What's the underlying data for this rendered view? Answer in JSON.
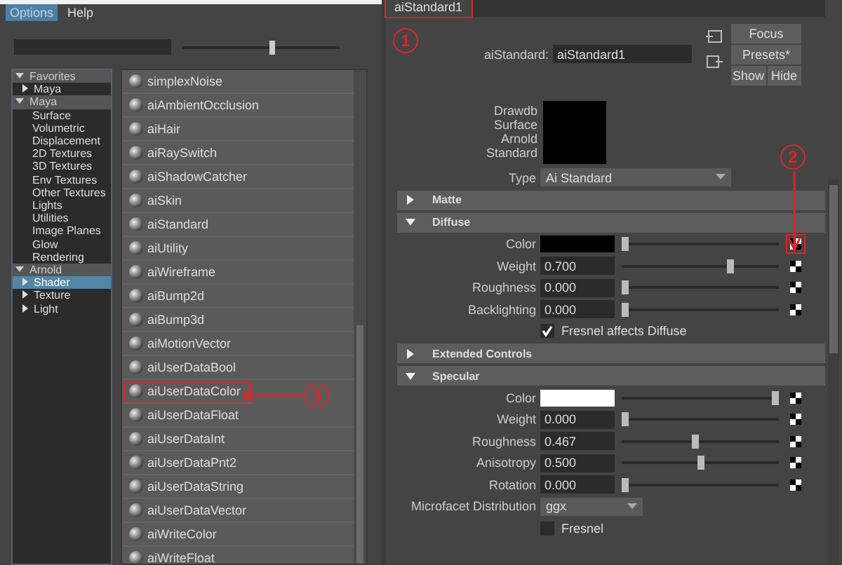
{
  "menu": [
    {
      "label": "Options",
      "selected": true
    },
    {
      "label": "Help",
      "selected": false
    }
  ],
  "zoom_slider": {
    "level": 0.55
  },
  "tree": [
    {
      "label": "Favorites",
      "kind": "group",
      "expanded": true,
      "selected": false,
      "children": [
        {
          "label": "Maya",
          "kind": "node",
          "expanded": false,
          "selected": false
        }
      ]
    },
    {
      "label": "Maya",
      "kind": "group",
      "expanded": true,
      "selected": false,
      "children": [
        {
          "label": "Surface",
          "kind": "leaf",
          "selected": false
        },
        {
          "label": "Volumetric",
          "kind": "leaf",
          "selected": false
        },
        {
          "label": "Displacement",
          "kind": "leaf",
          "selected": false
        },
        {
          "label": "2D Textures",
          "kind": "leaf",
          "selected": false
        },
        {
          "label": "3D Textures",
          "kind": "leaf",
          "selected": false
        },
        {
          "label": "Env Textures",
          "kind": "leaf",
          "selected": false
        },
        {
          "label": "Other Textures",
          "kind": "leaf",
          "selected": false
        },
        {
          "label": "Lights",
          "kind": "leaf",
          "selected": false
        },
        {
          "label": "Utilities",
          "kind": "leaf",
          "selected": false
        },
        {
          "label": "Image Planes",
          "kind": "leaf",
          "selected": false
        },
        {
          "label": "Glow",
          "kind": "leaf",
          "selected": false
        },
        {
          "label": "Rendering",
          "kind": "leaf",
          "selected": false
        }
      ]
    },
    {
      "label": "Arnold",
      "kind": "group",
      "expanded": true,
      "selected": false,
      "children": [
        {
          "label": "Shader",
          "kind": "node",
          "expanded": false,
          "selected": true
        },
        {
          "label": "Texture",
          "kind": "node",
          "expanded": false,
          "selected": false
        },
        {
          "label": "Light",
          "kind": "node",
          "expanded": false,
          "selected": false
        }
      ]
    }
  ],
  "nodes": [
    {
      "label": "simplexNoise",
      "annotated": false
    },
    {
      "label": "aiAmbientOcclusion",
      "annotated": false
    },
    {
      "label": "aiHair",
      "annotated": false
    },
    {
      "label": "aiRaySwitch",
      "annotated": false
    },
    {
      "label": "aiShadowCatcher",
      "annotated": false
    },
    {
      "label": "aiSkin",
      "annotated": false
    },
    {
      "label": "aiStandard",
      "annotated": false
    },
    {
      "label": "aiUtility",
      "annotated": false
    },
    {
      "label": "aiWireframe",
      "annotated": false
    },
    {
      "label": "aiBump2d",
      "annotated": false
    },
    {
      "label": "aiBump3d",
      "annotated": false
    },
    {
      "label": "aiMotionVector",
      "annotated": false
    },
    {
      "label": "aiUserDataBool",
      "annotated": false
    },
    {
      "label": "aiUserDataColor",
      "annotated": true
    },
    {
      "label": "aiUserDataFloat",
      "annotated": false
    },
    {
      "label": "aiUserDataInt",
      "annotated": false
    },
    {
      "label": "aiUserDataPnt2",
      "annotated": false
    },
    {
      "label": "aiUserDataString",
      "annotated": false
    },
    {
      "label": "aiUserDataVector",
      "annotated": false
    },
    {
      "label": "aiWriteColor",
      "annotated": false
    },
    {
      "label": "aiWriteFloat",
      "annotated": false
    }
  ],
  "tab": {
    "label": "aiStandard1",
    "annotated": true
  },
  "node_name": {
    "label": "aiStandard:",
    "value": "aiStandard1"
  },
  "buttons": [
    "Focus",
    "Presets*",
    "Show",
    "Hide"
  ],
  "swatch": {
    "label": "Drawdb Surface Arnold Standard"
  },
  "type": {
    "label": "Type",
    "value": "Ai Standard"
  },
  "sections": [
    {
      "title": "Matte",
      "expanded": false
    },
    {
      "title": "Diffuse",
      "expanded": true,
      "attributes": [
        {
          "kind": "color",
          "label": "Color",
          "color": "#000000",
          "level": 0,
          "annotated": true
        },
        {
          "kind": "number",
          "label": "Weight",
          "value": "0.700",
          "level": 0.7,
          "annotated": false
        },
        {
          "kind": "number",
          "label": "Roughness",
          "value": "0.000",
          "level": 0,
          "annotated": false
        },
        {
          "kind": "number",
          "label": "Backlighting",
          "value": "0.000",
          "level": 0,
          "annotated": false
        },
        {
          "kind": "checkbox",
          "label": "Fresnel affects Diffuse",
          "checked": true
        }
      ]
    },
    {
      "title": "Extended Controls",
      "expanded": false
    },
    {
      "title": "Specular",
      "expanded": true,
      "attributes": [
        {
          "kind": "color",
          "label": "Color",
          "color": "#ffffff",
          "level": 1,
          "annotated": false
        },
        {
          "kind": "number",
          "label": "Weight",
          "value": "0.000",
          "level": 0,
          "annotated": false
        },
        {
          "kind": "number",
          "label": "Roughness",
          "value": "0.467",
          "level": 0.467,
          "annotated": false
        },
        {
          "kind": "number",
          "label": "Anisotropy",
          "value": "0.500",
          "level": 0.5,
          "annotated": false
        },
        {
          "kind": "number",
          "label": "Rotation",
          "value": "0.000",
          "level": 0,
          "annotated": false
        },
        {
          "kind": "dropdown",
          "label": "Microfacet Distribution",
          "value": "ggx"
        },
        {
          "kind": "checkbox",
          "label": "Fresnel",
          "checked": false
        }
      ]
    }
  ],
  "annotations": [
    "1",
    "2",
    "3"
  ]
}
